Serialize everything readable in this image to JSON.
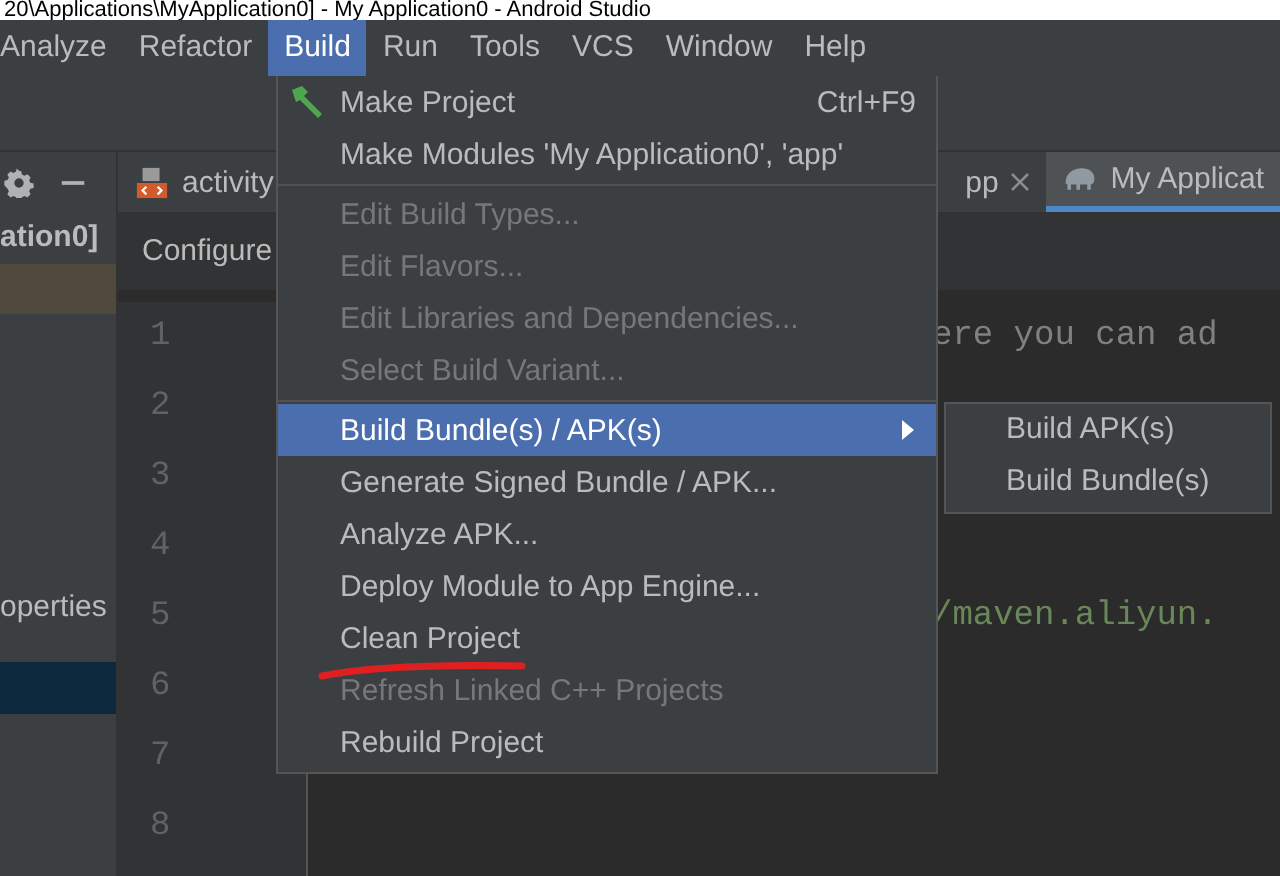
{
  "window": {
    "title": "20\\Applications\\MyApplication0] - My Application0 - Android Studio"
  },
  "menu_bar": [
    {
      "label": "Analyze",
      "selected": false
    },
    {
      "label": "Refactor",
      "selected": false
    },
    {
      "label": "Build",
      "selected": true
    },
    {
      "label": "Run",
      "selected": false
    },
    {
      "label": "Tools",
      "selected": false
    },
    {
      "label": "VCS",
      "selected": false
    },
    {
      "label": "Window",
      "selected": false
    },
    {
      "label": "Help",
      "selected": false
    }
  ],
  "tool_window": {
    "title": "ation0]",
    "items": [
      {
        "label": "operties",
        "selected": false
      }
    ]
  },
  "editor": {
    "tabs": [
      {
        "label": "activity",
        "selected": false
      },
      {
        "label": "pp",
        "closable": true,
        "selected": false
      },
      {
        "label": "My Applicat",
        "closable": false,
        "selected": true
      }
    ],
    "breadcrumb": "Configure",
    "lines": [
      {
        "number": "1",
        "code": "ere you can ad",
        "kind": "comment"
      },
      {
        "number": "2"
      },
      {
        "number": "3"
      },
      {
        "number": "4"
      },
      {
        "number": "5",
        "code": "/maven.aliyun.",
        "kind": "string"
      },
      {
        "number": "6"
      },
      {
        "number": "7"
      },
      {
        "number": "8"
      }
    ]
  },
  "menu": {
    "items": [
      {
        "kind": "item",
        "label": "Make Project",
        "shortcut": "Ctrl+F9",
        "disabled": false,
        "selected": false,
        "submenu": false,
        "marked": false
      },
      {
        "kind": "item",
        "label": "Make Modules 'My Application0', 'app'",
        "disabled": false,
        "selected": false,
        "submenu": false,
        "marked": false
      },
      {
        "kind": "separator"
      },
      {
        "kind": "item",
        "label": "Edit Build Types...",
        "disabled": true,
        "selected": false,
        "submenu": false,
        "marked": false
      },
      {
        "kind": "item",
        "label": "Edit Flavors...",
        "disabled": true,
        "selected": false,
        "submenu": false,
        "marked": false
      },
      {
        "kind": "item",
        "label": "Edit Libraries and Dependencies...",
        "disabled": true,
        "selected": false,
        "submenu": false,
        "marked": false
      },
      {
        "kind": "item",
        "label": "Select Build Variant...",
        "disabled": true,
        "selected": false,
        "submenu": false,
        "marked": false
      },
      {
        "kind": "separator"
      },
      {
        "kind": "item",
        "label": "Build Bundle(s) / APK(s)",
        "disabled": false,
        "selected": true,
        "submenu": true,
        "marked": false
      },
      {
        "kind": "item",
        "label": "Generate Signed Bundle / APK...",
        "disabled": false,
        "selected": false,
        "submenu": false,
        "marked": false
      },
      {
        "kind": "item",
        "label": "Analyze APK...",
        "disabled": false,
        "selected": false,
        "submenu": false,
        "marked": false
      },
      {
        "kind": "item",
        "label": "Deploy Module to App Engine...",
        "disabled": false,
        "selected": false,
        "submenu": false,
        "marked": false
      },
      {
        "kind": "item",
        "label": "Clean Project",
        "disabled": false,
        "selected": false,
        "submenu": false,
        "marked": true
      },
      {
        "kind": "item",
        "label": "Refresh Linked C++ Projects",
        "disabled": true,
        "selected": false,
        "submenu": false,
        "marked": false
      },
      {
        "kind": "item",
        "label": "Rebuild Project",
        "disabled": false,
        "selected": false,
        "submenu": false,
        "marked": false
      }
    ]
  },
  "submenu": {
    "items": [
      {
        "label": "Build APK(s)",
        "selected": false
      },
      {
        "label": "Build Bundle(s)",
        "selected": false
      }
    ]
  }
}
